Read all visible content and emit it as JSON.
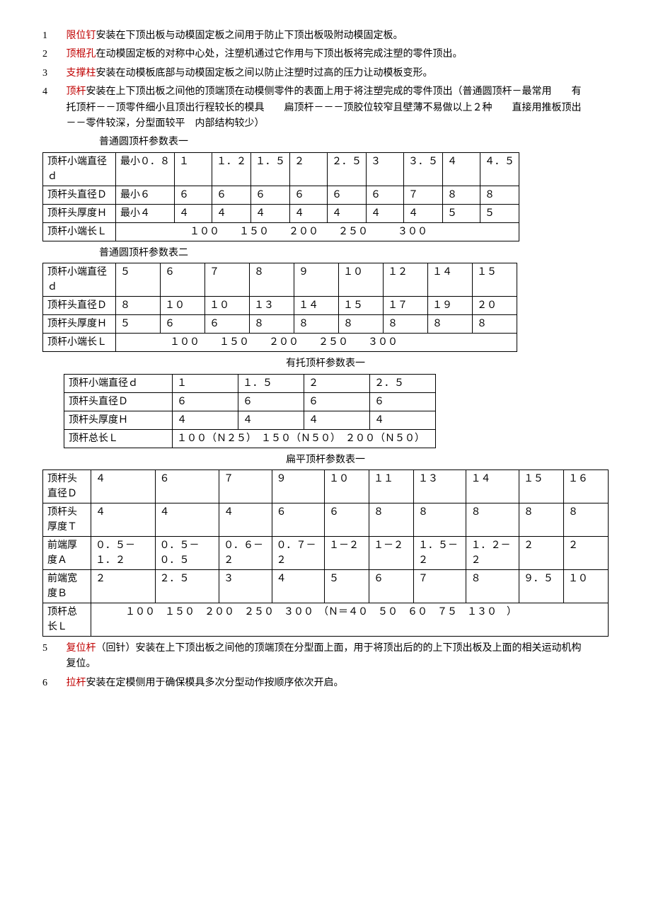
{
  "items": {
    "1": {
      "num": "1",
      "term": "限位钉",
      "rest": "安装在下顶出板与动模固定板之间用于防止下顶出板吸附动模固定板。"
    },
    "2": {
      "num": "2",
      "term": "顶棍孔",
      "rest": "在动模固定板的对称中心处，注塑机通过它作用与下顶出板将完成注塑的零件顶出。"
    },
    "3": {
      "num": "3",
      "term": "支撑柱",
      "rest": "安装在动模板底部与动模固定板之间以防止注塑时过高的压力让动模板变形。"
    },
    "4": {
      "num": "4",
      "term": "顶杆",
      "rest": "安装在上下顶出板之间他的顶端顶在动模侧零件的表面上用于将注塑完成的零件顶出（普通圆顶杆－最常用　　有托顶杆－－顶零件细小且顶出行程较长的模具　　扁顶杆－－－顶胶位较窄且壁薄不易做以上２种　　直接用推板顶出－－零件较深，分型面较平　内部结构较少）"
    },
    "5": {
      "num": "5",
      "term": "复位杆",
      "rest": "（回针）安装在上下顶出板之间他的顶端顶在分型面上面，用于将顶出后的的上下顶出板及上面的相关运动机构复位。"
    },
    "6": {
      "num": "6",
      "term": "拉杆",
      "rest": "安装在定模侧用于确保模具多次分型动作按顺序依次开启。"
    }
  },
  "captions": {
    "t1": "普通圆顶杆参数表一",
    "t2": "普通圆顶杆参数表二",
    "t3": "有托顶杆参数表一",
    "t4": "扁平顶杆参数表一"
  },
  "t1": {
    "r1": {
      "h": "顶杆小端直径ｄ",
      "c": [
        "最小０．８",
        "１",
        "１．２",
        "１．５",
        "２",
        "２．５",
        "３",
        "３．５",
        "４",
        "４．５"
      ]
    },
    "r2": {
      "h": "顶杆头直径Ｄ",
      "c": [
        "最小６",
        "６",
        "６",
        "６",
        "６",
        "６",
        "６",
        "７",
        "８",
        "８"
      ]
    },
    "r3": {
      "h": "顶杆头厚度Ｈ",
      "c": [
        "最小４",
        "４",
        "４",
        "４",
        "４",
        "４",
        "４",
        "４",
        "５",
        "５"
      ]
    },
    "r4": {
      "h": "顶杆小端长Ｌ",
      "c": "　　　　　　　１００　　１５０　　２００　　２５０　　　３００"
    }
  },
  "t2": {
    "r1": {
      "h": "顶杆小端直径ｄ",
      "c": [
        "５",
        "６",
        "７",
        "８",
        "９",
        "１０",
        "１２",
        "１４",
        "１５"
      ]
    },
    "r2": {
      "h": "顶杆头直径Ｄ",
      "c": [
        "８",
        "１０",
        "１０",
        "１３",
        "１４",
        "１５",
        "１７",
        "１９",
        "２０"
      ]
    },
    "r3": {
      "h": "顶杆头厚度Ｈ",
      "c": [
        "５",
        "６",
        "６",
        "８",
        "８",
        "８",
        "８",
        "８",
        "８"
      ]
    },
    "r4": {
      "h": "顶杆小端长Ｌ",
      "c": "　　　　　１００　　１５０　　２００　　２５０　　３００"
    }
  },
  "t3": {
    "r1": {
      "h": "顶杆小端直径ｄ",
      "c": [
        "１",
        "１．５",
        "２",
        "２．５"
      ]
    },
    "r2": {
      "h": "顶杆头直径Ｄ",
      "c": [
        "６",
        "６",
        "６",
        "６"
      ]
    },
    "r3": {
      "h": "顶杆头厚度Ｈ",
      "c": [
        "４",
        "４",
        "４",
        "４"
      ]
    },
    "r4": {
      "h": "顶杆总长Ｌ",
      "c": "１００（Ｎ２５）　１５０（Ｎ５０）　２００（Ｎ５０）"
    }
  },
  "t4": {
    "r1": {
      "h": "顶杆头直径Ｄ",
      "c": [
        "４",
        "６",
        "７",
        "９",
        "１０",
        "１１",
        "１３",
        "１４",
        "１５",
        "１６"
      ]
    },
    "r2": {
      "h": "顶杆头厚度Ｔ",
      "c": [
        "４",
        "４",
        "４",
        "６",
        "６",
        "８",
        "８",
        "８",
        "８",
        "８"
      ]
    },
    "r3": {
      "h": "前端厚度Ａ",
      "c": [
        "０．５－１．２",
        "０．５－０．５",
        "０．６－２",
        "０．７－２",
        "１－２",
        "１－２",
        "１．５－２",
        "１．２－２",
        "２",
        "２"
      ]
    },
    "r4": {
      "h": "前端宽度Ｂ",
      "c": [
        "２",
        "２．５",
        "３",
        "４",
        "５",
        "６",
        "７",
        "８",
        "９．５",
        "１０"
      ]
    },
    "r5": {
      "h": "顶杆总长Ｌ",
      "c": "　　　１００　１５０　２００　２５０　３００　（Ｎ＝４０　５０　６０　７５　１３０　）"
    }
  }
}
